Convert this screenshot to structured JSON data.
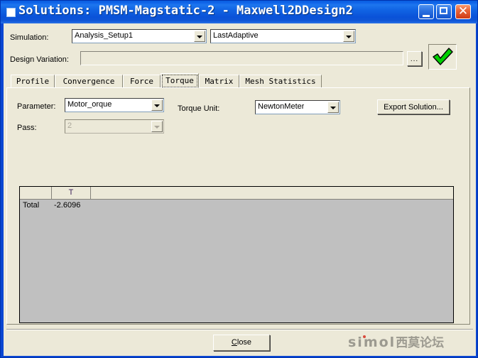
{
  "window": {
    "title": "Solutions: PMSM-Magstatic-2 - Maxwell2DDesign2",
    "icon": "app-icon",
    "controls": {
      "minimize": "minimize-icon",
      "maximize": "maximize-icon",
      "close": "close-icon",
      "close_glyph": "✕"
    }
  },
  "simulation_row": {
    "label": "Simulation:",
    "setup": {
      "value": "Analysis_Setup1",
      "options": [
        "Analysis_Setup1"
      ]
    },
    "adaptive": {
      "value": "LastAdaptive",
      "options": [
        "LastAdaptive"
      ]
    }
  },
  "design_variation_row": {
    "label": "Design Variation:",
    "value": "",
    "placeholder": "",
    "browse_label": "...",
    "apply_label": "✓"
  },
  "tabs": [
    {
      "label": "Profile",
      "selected": false
    },
    {
      "label": "Convergence",
      "selected": false
    },
    {
      "label": "Force",
      "selected": false
    },
    {
      "label": "Torque",
      "selected": true
    },
    {
      "label": "Matrix",
      "selected": false
    },
    {
      "label": "Mesh Statistics",
      "selected": false
    }
  ],
  "torque_panel": {
    "parameter": {
      "label": "Parameter:",
      "value": "Motor_orque",
      "options": [
        "Motor_orque"
      ]
    },
    "torque_unit": {
      "label": "Torque Unit:",
      "value": "NewtonMeter",
      "options": [
        "NewtonMeter"
      ]
    },
    "pass": {
      "label": "Pass:",
      "value": "2",
      "options": [
        "2"
      ],
      "disabled": true
    },
    "export_button": {
      "label": "Export Solution..."
    },
    "grid": {
      "columns": [
        "",
        "T",
        ""
      ],
      "rows": [
        {
          "name": "Total",
          "T": "-2.6096",
          "extra": ""
        }
      ]
    }
  },
  "footer": {
    "close_button": {
      "label": "Close",
      "accel": "C"
    },
    "watermark": {
      "latin": "simol",
      "cjk": "西莫论坛"
    }
  },
  "colors": {
    "titlebar_blue": "#0a52d8",
    "dialog_face": "#ece9d8",
    "grid_body": "#c0c0c0",
    "header_text": "#3b1f58",
    "close_red": "#cf3b16",
    "check_green": "#00d000",
    "watermark_gray": "#9c9a90",
    "watermark_dot_red": "#d94a3c"
  }
}
